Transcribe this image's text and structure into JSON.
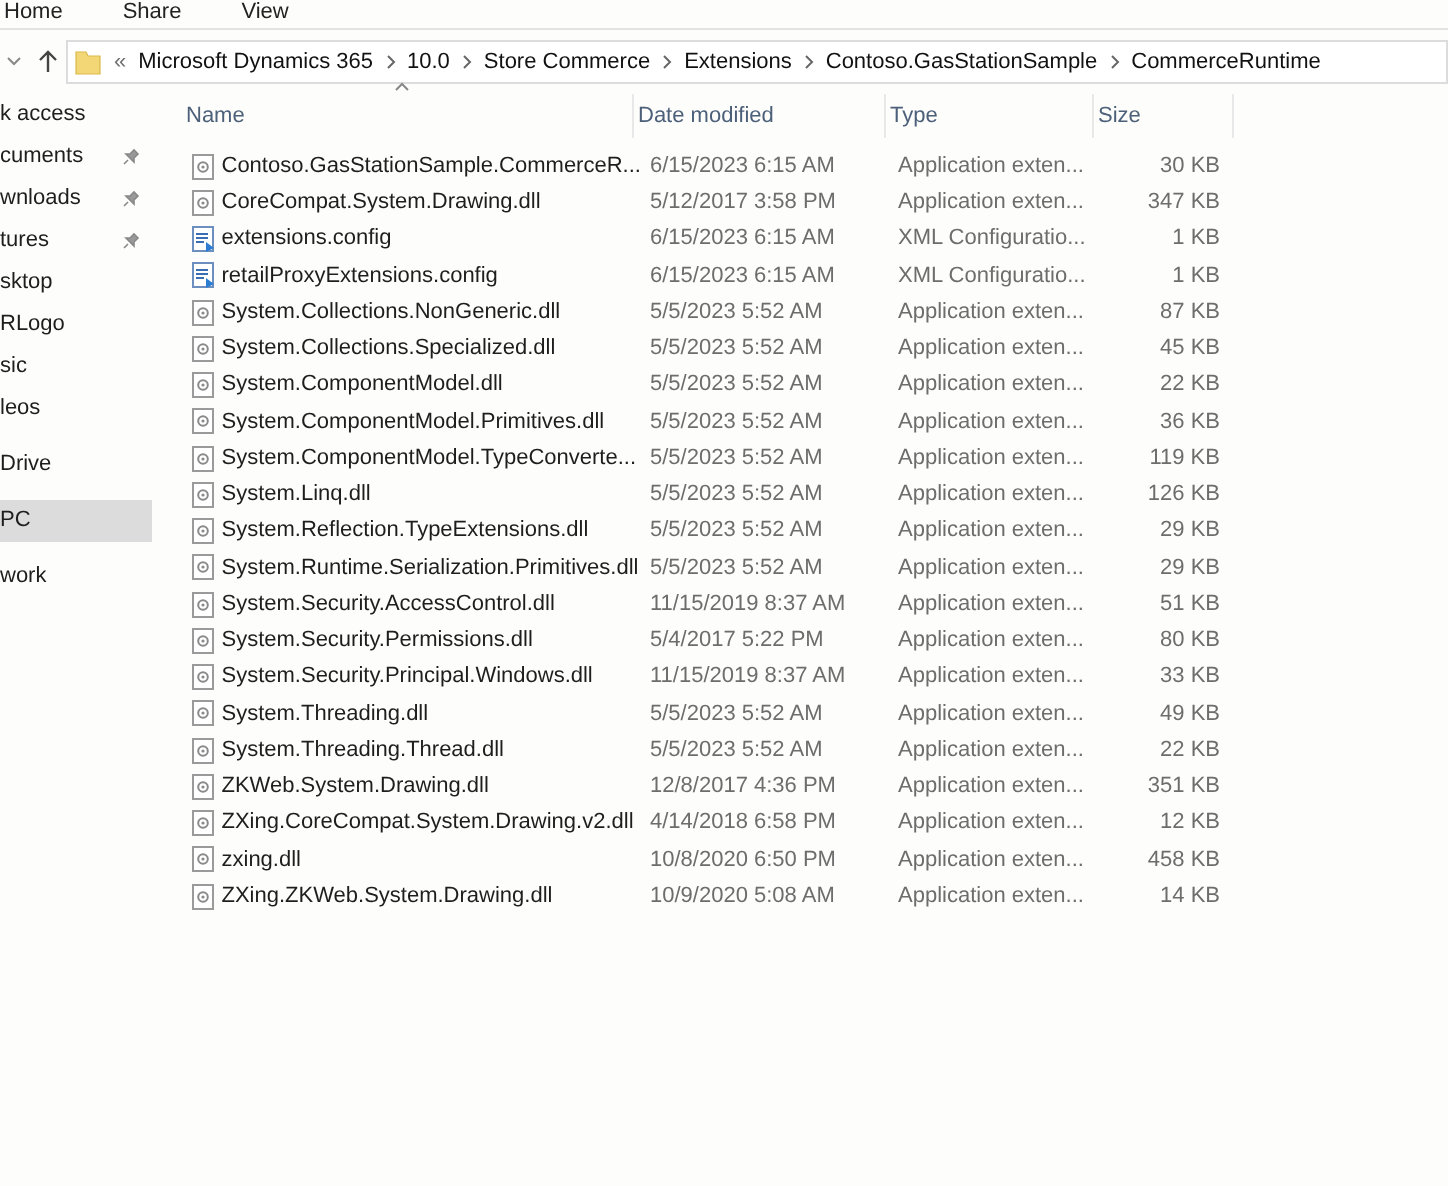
{
  "ribbon_tabs": [
    "Home",
    "Share",
    "View"
  ],
  "address_bar": {
    "prefix": "«",
    "crumbs": [
      "Microsoft Dynamics 365",
      "10.0",
      "Store Commerce",
      "Extensions",
      "Contoso.GasStationSample",
      "CommerceRuntime"
    ]
  },
  "sidebar": {
    "sections": [
      {
        "items": [
          {
            "label": "k access",
            "pinned": false,
            "selected": false
          },
          {
            "label": "cuments",
            "pinned": true,
            "selected": false
          },
          {
            "label": "wnloads",
            "pinned": true,
            "selected": false
          },
          {
            "label": "tures",
            "pinned": true,
            "selected": false
          },
          {
            "label": "sktop",
            "pinned": false,
            "selected": false
          },
          {
            "label": "RLogo",
            "pinned": false,
            "selected": false
          },
          {
            "label": "sic",
            "pinned": false,
            "selected": false
          },
          {
            "label": "leos",
            "pinned": false,
            "selected": false
          }
        ]
      },
      {
        "items": [
          {
            "label": "Drive",
            "pinned": false,
            "selected": false
          }
        ]
      },
      {
        "items": [
          {
            "label": "PC",
            "pinned": false,
            "selected": true
          }
        ]
      },
      {
        "items": [
          {
            "label": "work",
            "pinned": false,
            "selected": false
          }
        ]
      }
    ]
  },
  "table": {
    "columns": [
      "Name",
      "Date modified",
      "Type",
      "Size"
    ],
    "rows": [
      {
        "kind": "dll",
        "name": "Contoso.GasStationSample.CommerceR...",
        "date": "6/15/2023 6:15 AM",
        "type": "Application exten...",
        "size": "30 KB"
      },
      {
        "kind": "dll",
        "name": "CoreCompat.System.Drawing.dll",
        "date": "5/12/2017 3:58 PM",
        "type": "Application exten...",
        "size": "347 KB"
      },
      {
        "kind": "config",
        "name": "extensions.config",
        "date": "6/15/2023 6:15 AM",
        "type": "XML Configuratio...",
        "size": "1 KB"
      },
      {
        "kind": "config",
        "name": "retailProxyExtensions.config",
        "date": "6/15/2023 6:15 AM",
        "type": "XML Configuratio...",
        "size": "1 KB"
      },
      {
        "kind": "dll",
        "name": "System.Collections.NonGeneric.dll",
        "date": "5/5/2023 5:52 AM",
        "type": "Application exten...",
        "size": "87 KB"
      },
      {
        "kind": "dll",
        "name": "System.Collections.Specialized.dll",
        "date": "5/5/2023 5:52 AM",
        "type": "Application exten...",
        "size": "45 KB"
      },
      {
        "kind": "dll",
        "name": "System.ComponentModel.dll",
        "date": "5/5/2023 5:52 AM",
        "type": "Application exten...",
        "size": "22 KB"
      },
      {
        "kind": "dll",
        "name": "System.ComponentModel.Primitives.dll",
        "date": "5/5/2023 5:52 AM",
        "type": "Application exten...",
        "size": "36 KB"
      },
      {
        "kind": "dll",
        "name": "System.ComponentModel.TypeConverte...",
        "date": "5/5/2023 5:52 AM",
        "type": "Application exten...",
        "size": "119 KB"
      },
      {
        "kind": "dll",
        "name": "System.Linq.dll",
        "date": "5/5/2023 5:52 AM",
        "type": "Application exten...",
        "size": "126 KB"
      },
      {
        "kind": "dll",
        "name": "System.Reflection.TypeExtensions.dll",
        "date": "5/5/2023 5:52 AM",
        "type": "Application exten...",
        "size": "29 KB"
      },
      {
        "kind": "dll",
        "name": "System.Runtime.Serialization.Primitives.dll",
        "date": "5/5/2023 5:52 AM",
        "type": "Application exten...",
        "size": "29 KB"
      },
      {
        "kind": "dll",
        "name": "System.Security.AccessControl.dll",
        "date": "11/15/2019 8:37 AM",
        "type": "Application exten...",
        "size": "51 KB"
      },
      {
        "kind": "dll",
        "name": "System.Security.Permissions.dll",
        "date": "5/4/2017 5:22 PM",
        "type": "Application exten...",
        "size": "80 KB"
      },
      {
        "kind": "dll",
        "name": "System.Security.Principal.Windows.dll",
        "date": "11/15/2019 8:37 AM",
        "type": "Application exten...",
        "size": "33 KB"
      },
      {
        "kind": "dll",
        "name": "System.Threading.dll",
        "date": "5/5/2023 5:52 AM",
        "type": "Application exten...",
        "size": "49 KB"
      },
      {
        "kind": "dll",
        "name": "System.Threading.Thread.dll",
        "date": "5/5/2023 5:52 AM",
        "type": "Application exten...",
        "size": "22 KB"
      },
      {
        "kind": "dll",
        "name": "ZKWeb.System.Drawing.dll",
        "date": "12/8/2017 4:36 PM",
        "type": "Application exten...",
        "size": "351 KB"
      },
      {
        "kind": "dll",
        "name": "ZXing.CoreCompat.System.Drawing.v2.dll",
        "date": "4/14/2018 6:58 PM",
        "type": "Application exten...",
        "size": "12 KB"
      },
      {
        "kind": "dll",
        "name": "zxing.dll",
        "date": "10/8/2020 6:50 PM",
        "type": "Application exten...",
        "size": "458 KB"
      },
      {
        "kind": "dll",
        "name": "ZXing.ZKWeb.System.Drawing.dll",
        "date": "10/9/2020 5:08 AM",
        "type": "Application exten...",
        "size": "14 KB"
      }
    ]
  }
}
